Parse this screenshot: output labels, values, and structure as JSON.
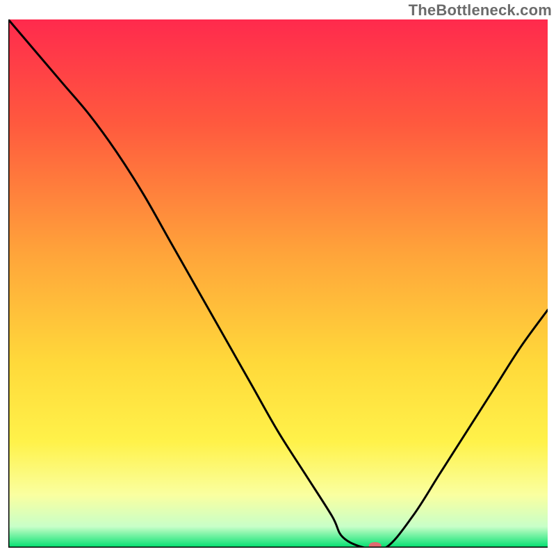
{
  "watermark": "TheBottleneck.com",
  "chart_data": {
    "type": "line",
    "title": "",
    "xlabel": "",
    "ylabel": "",
    "xlim": [
      0,
      100
    ],
    "ylim": [
      0,
      100
    ],
    "grid": false,
    "legend": false,
    "background_gradient": {
      "stops": [
        {
          "offset": 0.0,
          "color": "#ff2a4d"
        },
        {
          "offset": 0.2,
          "color": "#ff5a3e"
        },
        {
          "offset": 0.45,
          "color": "#ffa63a"
        },
        {
          "offset": 0.65,
          "color": "#ffd93a"
        },
        {
          "offset": 0.8,
          "color": "#fff24a"
        },
        {
          "offset": 0.9,
          "color": "#faffa0"
        },
        {
          "offset": 0.96,
          "color": "#c8ffc8"
        },
        {
          "offset": 1.0,
          "color": "#00e070"
        }
      ]
    },
    "series": [
      {
        "name": "bottleneck-curve",
        "x": [
          0,
          5,
          10,
          15,
          20,
          25,
          30,
          35,
          40,
          45,
          50,
          55,
          60,
          62,
          66,
          70,
          75,
          80,
          85,
          90,
          95,
          100
        ],
        "y": [
          100,
          94,
          88,
          82,
          75,
          67,
          58,
          49,
          40,
          31,
          22,
          14,
          6,
          2,
          0,
          0,
          6,
          14,
          22,
          30,
          38,
          45
        ]
      }
    ],
    "optimum_marker": {
      "x": 68,
      "y": 0,
      "color": "#e06a70",
      "rx": 9,
      "ry": 5
    }
  }
}
